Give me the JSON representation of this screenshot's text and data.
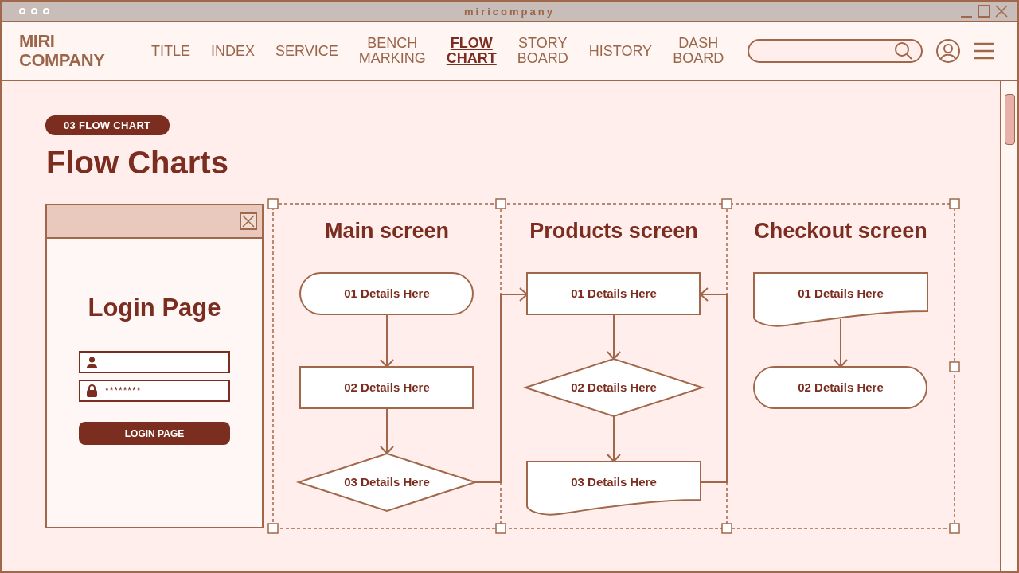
{
  "window": {
    "title": "miricompany"
  },
  "header": {
    "logo": [
      "MIRI",
      "COMPANY"
    ],
    "nav": [
      {
        "lines": [
          "TITLE"
        ],
        "selected": false
      },
      {
        "lines": [
          "INDEX"
        ],
        "selected": false
      },
      {
        "lines": [
          "SERVICE"
        ],
        "selected": false
      },
      {
        "lines": [
          "BENCH",
          "MARKING"
        ],
        "selected": false
      },
      {
        "lines": [
          "FLOW",
          "CHART"
        ],
        "selected": true
      },
      {
        "lines": [
          "STORY",
          "BOARD"
        ],
        "selected": false
      },
      {
        "lines": [
          "HISTORY"
        ],
        "selected": false
      },
      {
        "lines": [
          "DASH",
          "BOARD"
        ],
        "selected": false
      }
    ]
  },
  "badge": "03 FLOW CHART",
  "title": "Flow Charts",
  "login": {
    "title": "Login Page",
    "password": "********",
    "button": "LOGIN PAGE"
  },
  "flowchart": {
    "columns": [
      {
        "title": "Main screen",
        "nodes": [
          {
            "kind": "terminal",
            "label": "01 Details Here"
          },
          {
            "kind": "process",
            "label": "02 Details Here"
          },
          {
            "kind": "decision",
            "label": "03 Details Here"
          }
        ]
      },
      {
        "title": "Products screen",
        "nodes": [
          {
            "kind": "process",
            "label": "01 Details Here"
          },
          {
            "kind": "decision",
            "label": "02 Details Here"
          },
          {
            "kind": "document",
            "label": "03 Details Here"
          }
        ]
      },
      {
        "title": "Checkout screen",
        "nodes": [
          {
            "kind": "document",
            "label": "01 Details Here"
          },
          {
            "kind": "terminal",
            "label": "02 Details Here"
          }
        ]
      }
    ]
  }
}
